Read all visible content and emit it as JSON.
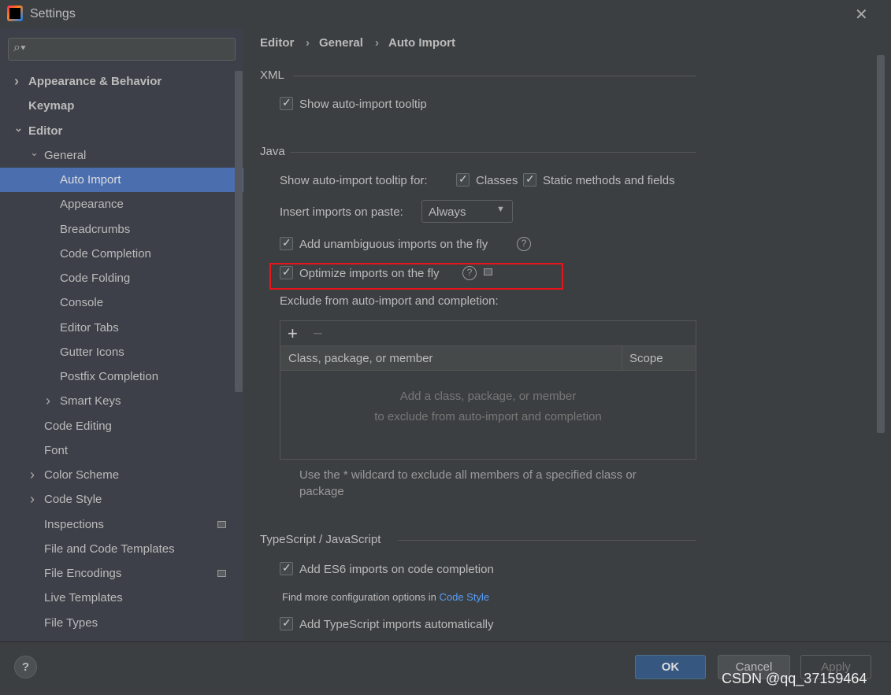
{
  "window": {
    "title": "Settings"
  },
  "search": {
    "placeholder": ""
  },
  "sidebar": {
    "items": [
      {
        "label": "Appearance & Behavior",
        "level": 0,
        "chevron": "right",
        "bold": true
      },
      {
        "label": "Keymap",
        "level": 0,
        "bold": true
      },
      {
        "label": "Editor",
        "level": 0,
        "chevron": "down",
        "bold": true
      },
      {
        "label": "General",
        "level": 1,
        "chevron": "down"
      },
      {
        "label": "Auto Import",
        "level": 2,
        "selected": true
      },
      {
        "label": "Appearance",
        "level": 2
      },
      {
        "label": "Breadcrumbs",
        "level": 2
      },
      {
        "label": "Code Completion",
        "level": 2
      },
      {
        "label": "Code Folding",
        "level": 2
      },
      {
        "label": "Console",
        "level": 2
      },
      {
        "label": "Editor Tabs",
        "level": 2
      },
      {
        "label": "Gutter Icons",
        "level": 2
      },
      {
        "label": "Postfix Completion",
        "level": 2
      },
      {
        "label": "Smart Keys",
        "level": 2,
        "chevron": "right"
      },
      {
        "label": "Code Editing",
        "level": 1
      },
      {
        "label": "Font",
        "level": 1
      },
      {
        "label": "Color Scheme",
        "level": 1,
        "chevron": "right"
      },
      {
        "label": "Code Style",
        "level": 1,
        "chevron": "right"
      },
      {
        "label": "Inspections",
        "level": 1,
        "badge": true
      },
      {
        "label": "File and Code Templates",
        "level": 1
      },
      {
        "label": "File Encodings",
        "level": 1,
        "badge": true
      },
      {
        "label": "Live Templates",
        "level": 1
      },
      {
        "label": "File Types",
        "level": 1
      }
    ]
  },
  "breadcrumb": [
    "Editor",
    "General",
    "Auto Import"
  ],
  "xml": {
    "title": "XML",
    "show_tooltip": "Show auto-import tooltip"
  },
  "java": {
    "title": "Java",
    "tooltip_for": "Show auto-import tooltip for:",
    "classes": "Classes",
    "static": "Static methods and fields",
    "paste_label": "Insert imports on paste:",
    "paste_value": "Always",
    "unambiguous": "Add unambiguous imports on the fly",
    "optimize": "Optimize imports on the fly",
    "exclude_label": "Exclude from auto-import and completion:",
    "col_member": "Class, package, or member",
    "col_scope": "Scope",
    "empty1": "Add a class, package, or member",
    "empty2": "to exclude from auto-import and completion",
    "hint1": "Use the * wildcard to exclude all members of a specified class or",
    "hint2": "package"
  },
  "ts": {
    "title": "TypeScript / JavaScript",
    "es6": "Add ES6 imports on code completion",
    "more": "Find more configuration options in",
    "more_link": "Code Style",
    "ts_auto": "Add TypeScript imports automatically"
  },
  "footer": {
    "ok": "OK",
    "cancel": "Cancel",
    "apply": "Apply",
    "help": "?"
  },
  "watermark": "CSDN @qq_37159464",
  "colors": {
    "selection": "#4b6eaf",
    "ok_button": "#365880",
    "highlight_box": "#e8141c",
    "link": "#589df6"
  }
}
